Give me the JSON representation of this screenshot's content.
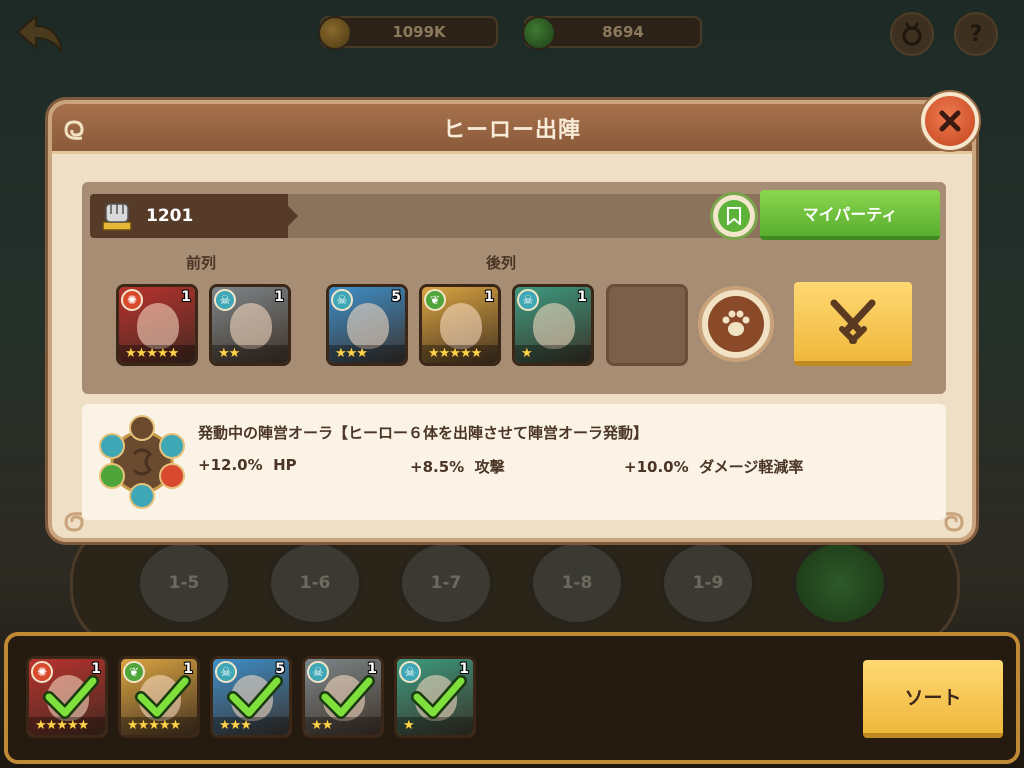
{
  "hud": {
    "gold": "1099K",
    "gems": "8694",
    "back_icon": "back-arrow-icon",
    "settings_icon": "medal-icon",
    "help_label": "?"
  },
  "stages": [
    "1-5",
    "1-6",
    "1-7",
    "1-8",
    "1-9"
  ],
  "modal": {
    "title": "ヒーロー出陣",
    "power": "1201",
    "my_party_label": "マイパーティ",
    "front_row_label": "前列",
    "back_row_label": "後列",
    "front_row": [
      {
        "faction": "fire",
        "level": "1",
        "stars": 5,
        "color": "#b8322e"
      },
      {
        "faction": "death",
        "level": "1",
        "stars": 2,
        "color": "#7d8689"
      }
    ],
    "back_row": [
      {
        "faction": "death",
        "level": "5",
        "stars": 3,
        "color": "#3e8fc9"
      },
      {
        "faction": "nature",
        "level": "1",
        "stars": 5,
        "color": "#d9a441"
      },
      {
        "faction": "death",
        "level": "1",
        "stars": 1,
        "color": "#3d9a80"
      }
    ],
    "aura": {
      "title": "発動中の陣営オーラ【ヒーロー６体を出陣させて陣営オーラ発動】",
      "stats": [
        {
          "value": "+12.0%",
          "label": "HP"
        },
        {
          "value": "+8.5%",
          "label": "攻撃"
        },
        {
          "value": "+10.0%",
          "label": "ダメージ軽減率"
        }
      ]
    }
  },
  "roster": {
    "sort_label": "ソート",
    "heroes": [
      {
        "faction": "fire",
        "level": "1",
        "stars": 5,
        "color": "#b8322e",
        "selected": true
      },
      {
        "faction": "nature",
        "level": "1",
        "stars": 5,
        "color": "#d9a441",
        "selected": true
      },
      {
        "faction": "death",
        "level": "5",
        "stars": 3,
        "color": "#3e8fc9",
        "selected": true
      },
      {
        "faction": "death",
        "level": "1",
        "stars": 2,
        "color": "#7d8689",
        "selected": true
      },
      {
        "faction": "death",
        "level": "1",
        "stars": 1,
        "color": "#3d9a80",
        "selected": true
      }
    ]
  },
  "colors": {
    "accent_green": "#5aae2f",
    "accent_gold": "#efb83c",
    "close_red": "#c2441e",
    "panel_bg": "#eedfc6"
  }
}
